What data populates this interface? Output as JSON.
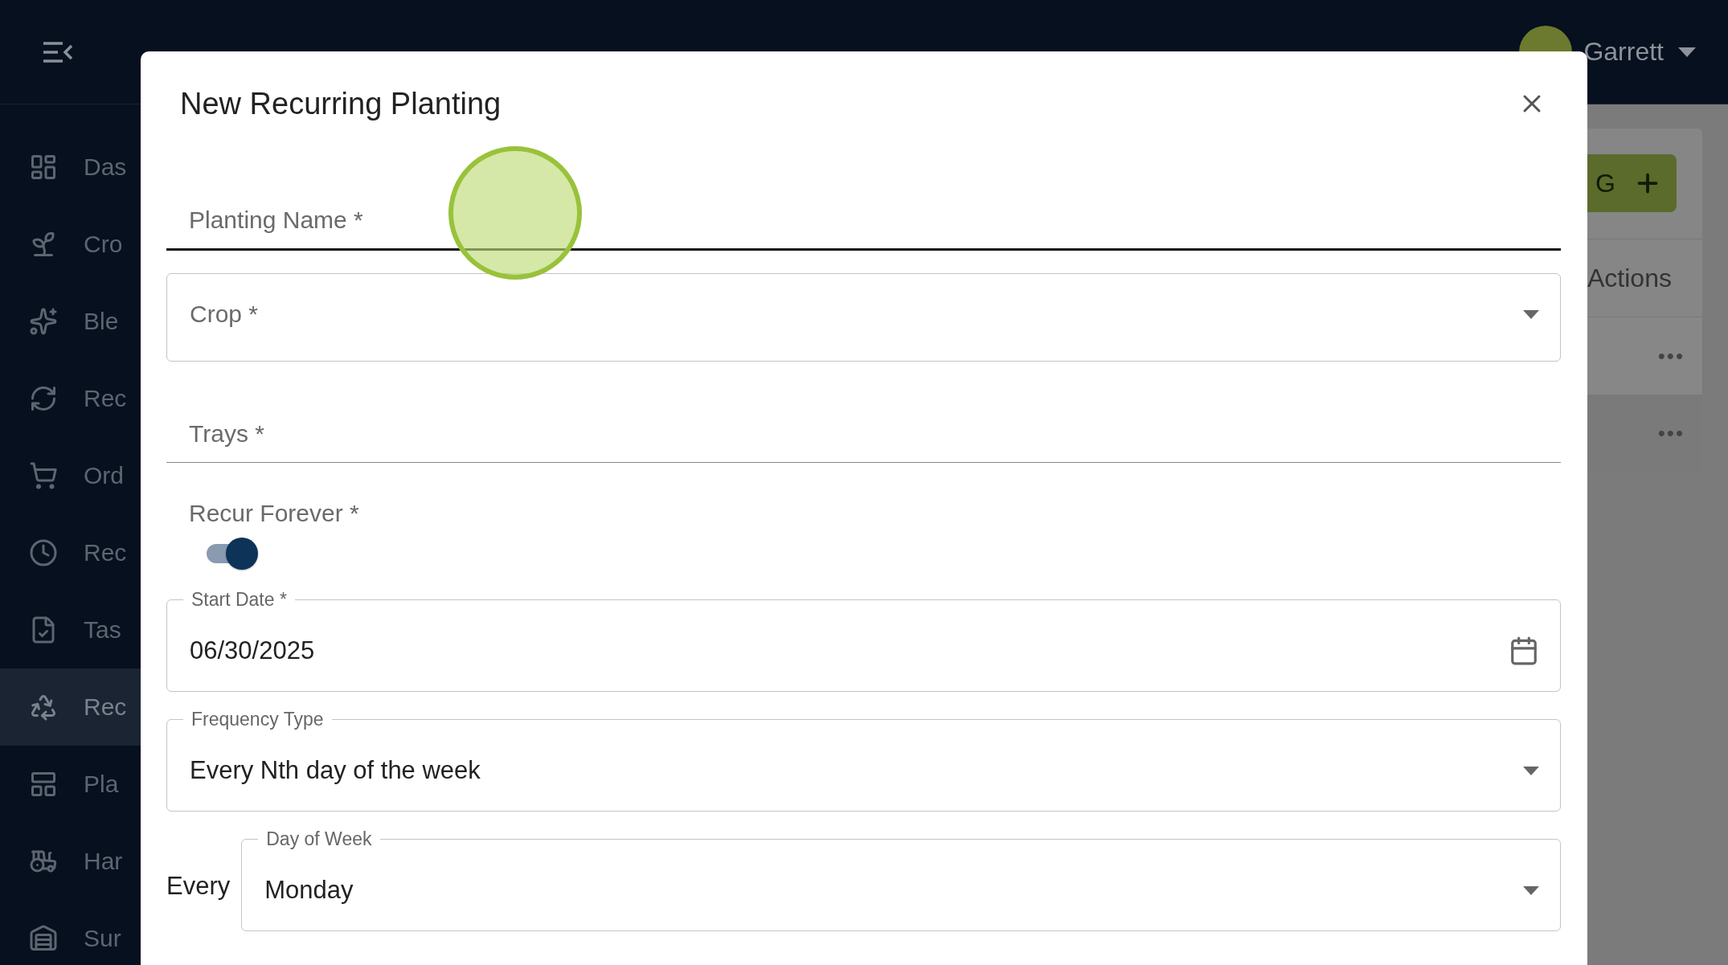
{
  "app_bar": {
    "user": {
      "name": "Garrett"
    }
  },
  "sidebar": {
    "items": [
      {
        "label": "Das",
        "selected": false
      },
      {
        "label": "Cro",
        "selected": false
      },
      {
        "label": "Ble",
        "selected": false
      },
      {
        "label": "Rec",
        "selected": false
      },
      {
        "label": "Ord",
        "selected": false
      },
      {
        "label": "Rec",
        "selected": false
      },
      {
        "label": "Tas",
        "selected": false
      },
      {
        "label": "Rec",
        "selected": true
      },
      {
        "label": "Pla",
        "selected": false
      },
      {
        "label": "Har",
        "selected": false
      },
      {
        "label": "Sur",
        "selected": false
      }
    ]
  },
  "content": {
    "add_button": "G",
    "column_header": "Actions",
    "rows": [
      {
        "actions": "•••"
      },
      {
        "actions": "•••"
      }
    ]
  },
  "dialog": {
    "title": "New Recurring Planting",
    "fields": [
      {
        "kind": "text",
        "label": "Planting Name *",
        "focused": true
      },
      {
        "kind": "select",
        "label": "Crop *"
      },
      {
        "kind": "text",
        "label": "Trays *",
        "focused": false
      },
      {
        "kind": "switch",
        "label": "Recur Forever *",
        "on": true
      },
      {
        "kind": "date",
        "label": "Start Date *",
        "value": "06/30/2025"
      },
      {
        "kind": "select",
        "label": "Frequency Type",
        "value": "Every Nth day of the week"
      },
      {
        "kind": "select",
        "label": "Day of Week",
        "value": "Monday",
        "prefix": "Every"
      }
    ]
  }
}
